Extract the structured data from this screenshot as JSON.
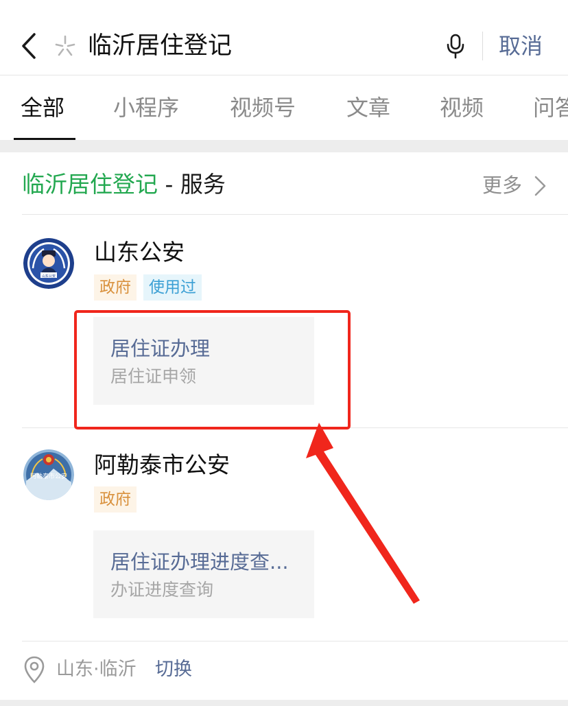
{
  "search": {
    "query": "临沂居住登记",
    "cancel_label": "取消"
  },
  "tabs": [
    {
      "label": "全部",
      "active": true
    },
    {
      "label": "小程序",
      "active": false
    },
    {
      "label": "视频号",
      "active": false
    },
    {
      "label": "文章",
      "active": false
    },
    {
      "label": "视频",
      "active": false
    },
    {
      "label": "问答",
      "active": false
    }
  ],
  "section": {
    "title_keyword": "临沂居住登记",
    "title_suffix": " - 服务",
    "more_label": "更多"
  },
  "results": [
    {
      "name": "山东公安",
      "logo_text": "山东公安",
      "tags": [
        "政府",
        "使用过"
      ],
      "service_title": "居住证办理",
      "service_subtitle": "居住证申领"
    },
    {
      "name": "阿勒泰市公安",
      "logo_text": "阿勒泰市公安",
      "tags": [
        "政府"
      ],
      "service_title": "居住证办理进度查...",
      "service_subtitle": "办证进度查询"
    }
  ],
  "footer": {
    "location": "山东·临沂",
    "switch_label": "切换"
  },
  "icons": {
    "back": "chevron-left-icon",
    "search_mark": "sparkle-icon",
    "voice": "microphone-icon",
    "more": "chevron-right-icon",
    "location": "location-pin-icon"
  },
  "colors": {
    "keyword_green": "#23a850",
    "link_blue": "#576b95",
    "annotation_red": "#f0261c",
    "tag_gov": "#d9913d",
    "tag_used": "#3a9fd4"
  }
}
